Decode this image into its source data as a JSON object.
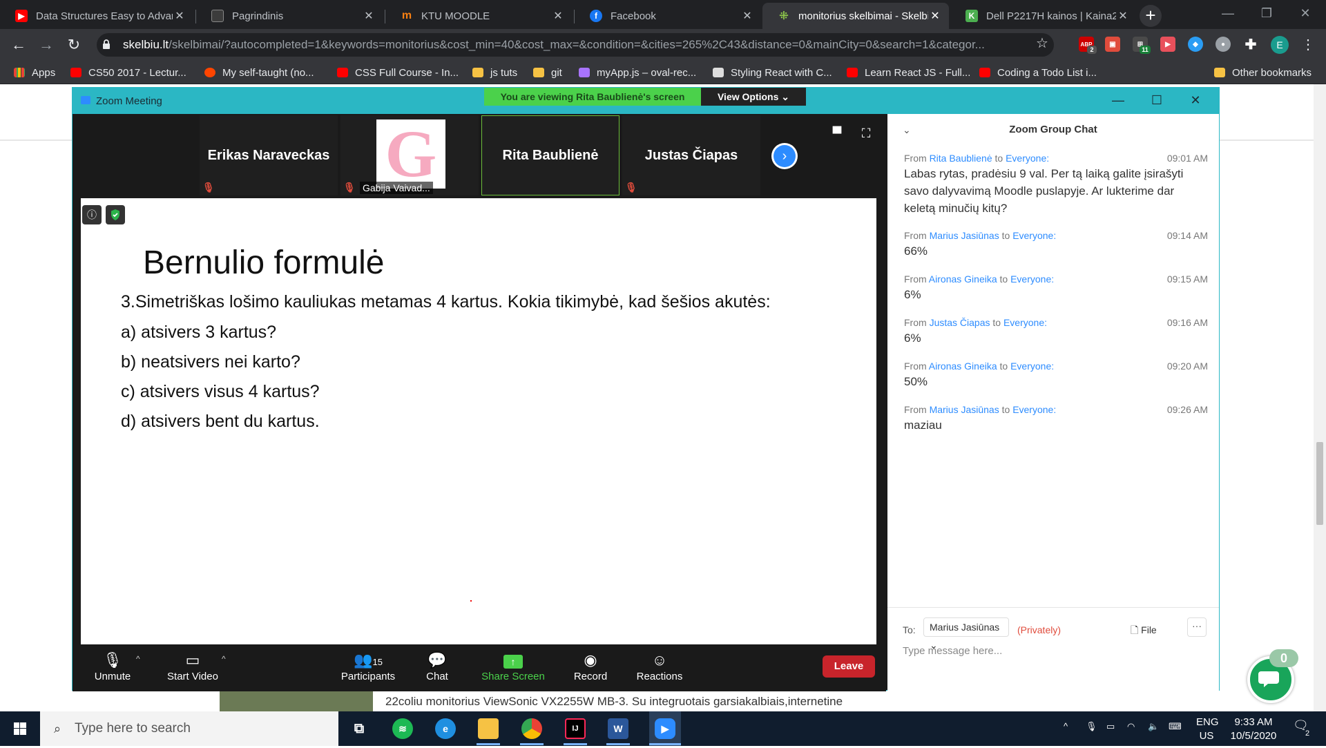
{
  "browser": {
    "tabs": [
      {
        "title": "Data Structures Easy to Advanced Course",
        "favicon_color": "#ff0000"
      },
      {
        "title": "Pagrindinis",
        "favicon_color": "#3c3c3c"
      },
      {
        "title": "KTU MOODLE",
        "favicon_color": "#f98012"
      },
      {
        "title": "Facebook",
        "favicon_color": "#1877f2"
      },
      {
        "title": "monitorius skelbimai - Skelbiu.lt",
        "favicon_color": "#8bc34a"
      },
      {
        "title": "Dell P2217H kainos | Kaina24.lt",
        "favicon_color": "#4caf50"
      }
    ],
    "favicon_letters": {
      "kaina": "K",
      "moodle": "m"
    },
    "new_tab_symbol": "+",
    "url_host": "skelbiu.lt",
    "url_path": "/skelbimai/?autocompleted=1&keywords=monitorius&cost_min=40&cost_max=&condition=&cities=265%2C43&distance=0&mainCity=0&search=1&categor...",
    "profile_initial": "E",
    "extension_badges": {
      "abp": "ABP",
      "abp_count": "2",
      "green_count": "11"
    },
    "bookmarks": [
      {
        "label": "Apps",
        "icon": "apps-grid-icon",
        "color": "#ea4335"
      },
      {
        "label": "CS50 2017 - Lectur...",
        "icon": "youtube-icon",
        "color": "#ff0000"
      },
      {
        "label": "My self-taught (no...",
        "icon": "reddit-icon",
        "color": "#ff4500"
      },
      {
        "label": "CSS Full Course - In...",
        "icon": "youtube-icon",
        "color": "#ff0000"
      },
      {
        "label": "js tuts",
        "icon": "folder-icon",
        "color": "#f6c244"
      },
      {
        "label": "git",
        "icon": "folder-icon",
        "color": "#f6c244"
      },
      {
        "label": "myApp.js – oval-rec...",
        "icon": "codepen-icon",
        "color": "#a974ff"
      },
      {
        "label": "Styling React with C...",
        "icon": "page-icon",
        "color": "#dddddd"
      },
      {
        "label": "Learn React JS - Full...",
        "icon": "youtube-icon",
        "color": "#ff0000"
      },
      {
        "label": "Coding a Todo List i...",
        "icon": "youtube-icon",
        "color": "#ff0000"
      }
    ],
    "other_bookmarks": "Other bookmarks"
  },
  "page_behind": {
    "listing_text": "22coliu monitorius ViewSonic VX2255W MB-3. Su integruotais garsiakalbiais,internetine",
    "chat_widget_count": "0"
  },
  "zoom": {
    "window_title": "Zoom Meeting",
    "viewing_banner": "You are viewing Rita Baublienė's screen",
    "view_options": "View Options",
    "participants": [
      {
        "name": "Erikas Naraveckas",
        "muted": true
      },
      {
        "name": "Gabija Vaivad...",
        "muted": true,
        "avatar_letter": "G"
      },
      {
        "name": "Rita Baublienė",
        "muted": false,
        "speaking": true
      },
      {
        "name": "Justas Čiapas",
        "muted": true
      }
    ],
    "slide": {
      "title": "Bernulio formulė",
      "lines": [
        "3.Simetriškas lošimo kauliukas metamas 4 kartus. Kokia tikimybė, kad šešios akutės:",
        "a) atsivers 3 kartus?",
        "b) neatsivers nei karto?",
        "c) atsivers visus 4 kartus?",
        "d) atsivers bent du kartus."
      ]
    },
    "controls": {
      "unmute": "Unmute",
      "start_video": "Start Video",
      "participants": "Participants",
      "participants_count": "15",
      "chat": "Chat",
      "share_screen": "Share Screen",
      "record": "Record",
      "reactions": "Reactions",
      "leave": "Leave"
    },
    "chat": {
      "title": "Zoom Group Chat",
      "from_word": "From",
      "to_word": "to",
      "everyone": "Everyone:",
      "messages": [
        {
          "from": "Rita Baublienė",
          "time": "09:01 AM",
          "text": "Labas rytas, pradėsiu 9 val. Per tą laiką galite įsirašyti savo dalyvavimą Moodle puslapyje. Ar lukterime dar keletą minučių kitų?"
        },
        {
          "from": "Marius Jasiūnas",
          "time": "09:14 AM",
          "text": "66%"
        },
        {
          "from": "Aironas Gineika",
          "time": "09:15 AM",
          "text": "6%"
        },
        {
          "from": "Justas Čiapas",
          "time": "09:16 AM",
          "text": "6%"
        },
        {
          "from": "Aironas Gineika",
          "time": "09:20 AM",
          "text": "50%"
        },
        {
          "from": "Marius Jasiūnas",
          "time": "09:26 AM",
          "text": "maziau"
        }
      ],
      "to_label": "To:",
      "recipient": "Marius Jasiūnas",
      "privately": "(Privately)",
      "file": "File",
      "placeholder": "Type message here..."
    }
  },
  "taskbar": {
    "search_placeholder": "Type here to search",
    "lang": "ENG",
    "region": "US",
    "time": "9:33 AM",
    "date": "10/5/2020",
    "notifications": "2",
    "word_letter": "W",
    "intellij_letters": "IJ"
  }
}
